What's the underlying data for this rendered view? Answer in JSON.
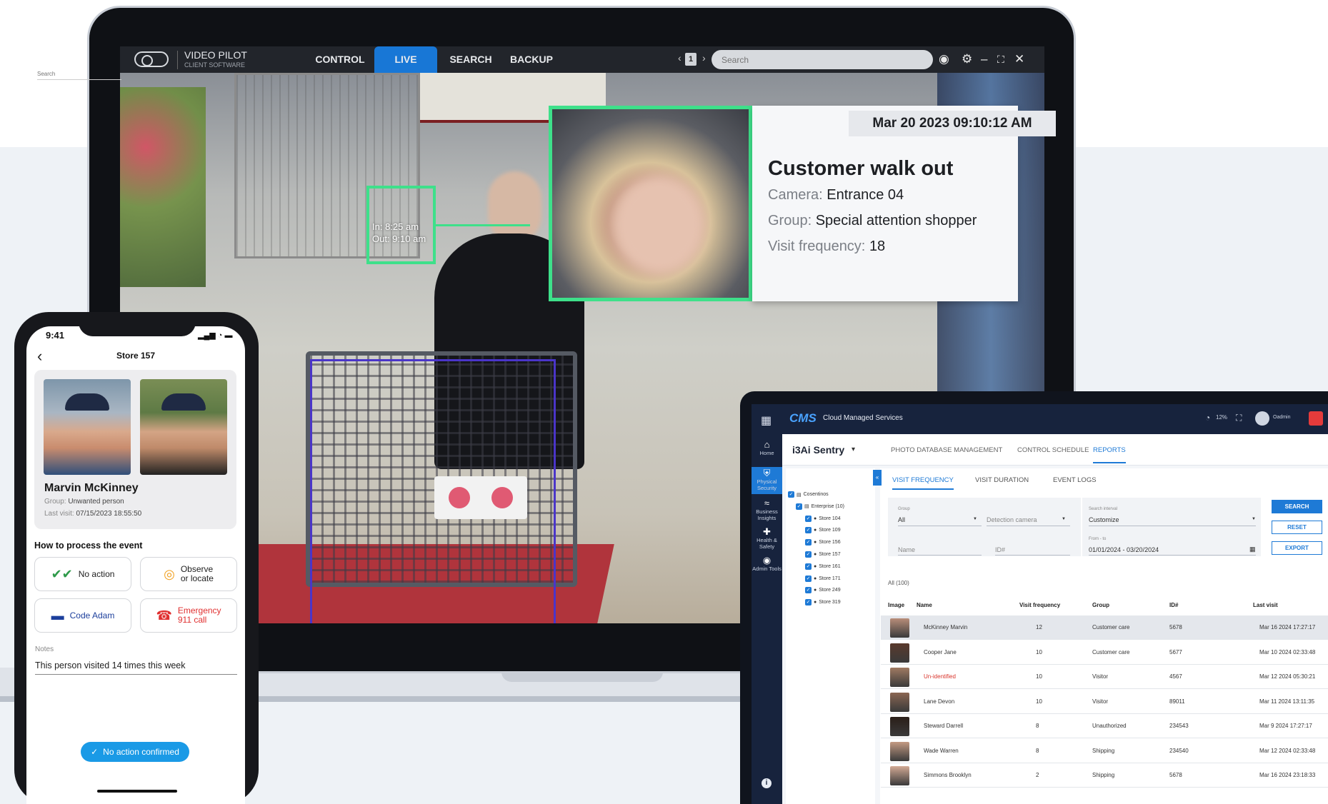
{
  "colors": {
    "accent_blue": "#1e7ad6",
    "live_tab": "#1877d6",
    "detect_green": "#3ee08a",
    "body_box": "#4a35c9",
    "cms_nav": "#17233d",
    "red_text": "#d9342b",
    "confirm": "#1a9ae6"
  },
  "video_pilot": {
    "title": "VIDEO PILOT",
    "subtitle": "CLIENT SOFTWARE",
    "tabs": [
      "CONTROL",
      "LIVE",
      "SEARCH",
      "BACKUP"
    ],
    "active_tab": "LIVE",
    "page_number": "1",
    "search_placeholder": "Search",
    "icons": [
      "chevron-left-icon",
      "chevron-right-icon",
      "record-icon",
      "gear-icon",
      "minimize-icon",
      "fullscreen-icon",
      "close-icon"
    ],
    "detection": {
      "in_time": "In: 8:25 am",
      "out_time": "Out: 9:10 am"
    },
    "alert": {
      "timestamp": "Mar 20 2023 09:10:12 AM",
      "title": "Customer walk out",
      "camera_label": "Camera:",
      "camera_value": "Entrance 04",
      "group_label": "Group:",
      "group_value": "Special attention shopper",
      "visit_label": "Visit frequency:",
      "visit_value": "18"
    }
  },
  "phone": {
    "status_time": "9:41",
    "status_icons": "▂▄▆ ◔ ▬",
    "back_icon": "‹",
    "title": "Store 157",
    "person_name": "Marvin McKinney",
    "group_label": "Group:",
    "group_value": "Unwanted person",
    "last_visit_label": "Last visit:",
    "last_visit_value": "07/15/2023 18:55:50",
    "section_title": "How to process the event",
    "actions": [
      {
        "label": "No action",
        "icon": "✔✔",
        "color": "#2e9a4a"
      },
      {
        "label": "Observe\nor locate",
        "icon": "◎",
        "color": "#f0a020"
      },
      {
        "label": "Code Adam",
        "icon": "▬",
        "color": "#1c3f9c"
      },
      {
        "label": "Emergency\n911 call",
        "icon": "☎",
        "color": "#e03030"
      }
    ],
    "notes_label": "Notes",
    "notes_value": "This person visited 14 times this week",
    "confirm_label": "No action confirmed"
  },
  "cms": {
    "logo": "CMS",
    "brand": "Cloud Managed Services",
    "top_right": {
      "progress": "12%",
      "user": "Oadmin"
    },
    "nav": [
      {
        "icon": "⌂",
        "label": "Home"
      },
      {
        "icon": "⛨",
        "label": "Physical Security"
      },
      {
        "icon": "≈",
        "label": "Business Insights"
      },
      {
        "icon": "✚",
        "label": "Health & Safety"
      },
      {
        "icon": "◉",
        "label": "Admin Tools"
      }
    ],
    "app_title": "i3Ai Sentry",
    "header_tabs": [
      "PHOTO DATABASE MANAGEMENT",
      "CONTROL SCHEDULE",
      "REPORTS"
    ],
    "sub_tabs": [
      "VISIT FREQUENCY",
      "VISIT DURATION",
      "EVENT LOGS"
    ],
    "tree_search": "Search",
    "tree": [
      "Cosentinos",
      "Enterprise (10)",
      "Store 104",
      "Store 109",
      "Store 156",
      "Store 157",
      "Store 161",
      "Store 171",
      "Store 249",
      "Store 319"
    ],
    "filters": {
      "group_label": "Group",
      "group_value": "All",
      "camera_placeholder": "Detection camera",
      "name_placeholder": "Name",
      "id_placeholder": "ID#",
      "interval_label": "Search interval",
      "interval_value": "Customize",
      "range_label": "From - to",
      "range_value": "01/01/2024 - 03/20/2024"
    },
    "buttons": [
      "SEARCH",
      "RESET",
      "EXPORT"
    ],
    "count": "All (100)",
    "columns": [
      "Image",
      "Name",
      "Visit frequency",
      "Group",
      "ID#",
      "Last visit"
    ],
    "rows": [
      {
        "name": "McKinney Marvin",
        "freq": "12",
        "group": "Customer care",
        "id": "5678",
        "last": "Mar 16 2024  17:27:17"
      },
      {
        "name": "Cooper Jane",
        "freq": "10",
        "group": "Customer care",
        "id": "5677",
        "last": "Mar 10 2024  02:33:48"
      },
      {
        "name": "Un-identified",
        "freq": "10",
        "group": "Visitor",
        "id": "4567",
        "last": "Mar 12 2024  05:30:21"
      },
      {
        "name": "Lane Devon",
        "freq": "10",
        "group": "Visitor",
        "id": "89011",
        "last": "Mar 11 2024  13:11:35"
      },
      {
        "name": "Steward Darrell",
        "freq": "8",
        "group": "Unauthorized",
        "id": "234543",
        "last": "Mar 9 2024  17:27:17"
      },
      {
        "name": "Wade Warren",
        "freq": "8",
        "group": "Shipping",
        "id": "234540",
        "last": "Mar 12 2024  02:33:48"
      },
      {
        "name": "Simmons Brooklyn",
        "freq": "2",
        "group": "Shipping",
        "id": "5678",
        "last": "Mar 16 2024  23:18:33"
      }
    ]
  }
}
